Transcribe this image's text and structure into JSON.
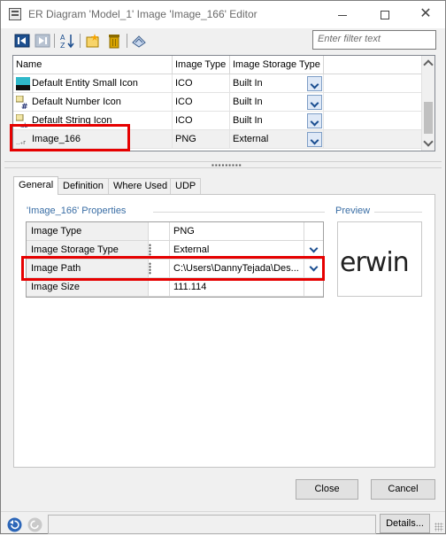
{
  "window": {
    "title": "ER Diagram 'Model_1' Image 'Image_166' Editor"
  },
  "toolbar": {
    "filter_placeholder": "Enter filter text"
  },
  "image_list": {
    "columns": [
      "Name",
      "Image Type",
      "Image Storage Type"
    ],
    "rows": [
      {
        "name": "Default Entity Small Icon",
        "type": "ICO",
        "storage": "Built In",
        "icon": "entity-icon"
      },
      {
        "name": "Default Number Icon",
        "type": "ICO",
        "storage": "Built In",
        "icon": "number-icon"
      },
      {
        "name": "Default String Icon",
        "type": "ICO",
        "storage": "Built In",
        "icon": "string-icon"
      },
      {
        "name": "Image_166",
        "type": "PNG",
        "storage": "External",
        "icon": "image-icon",
        "selected": true
      }
    ]
  },
  "tabs": [
    "General",
    "Definition",
    "Where Used",
    "UDP"
  ],
  "active_tab": "General",
  "properties": {
    "group_title": "'Image_166' Properties",
    "rows": [
      {
        "name": "Image Type",
        "value": "PNG",
        "has_dropdown": false
      },
      {
        "name": "Image Storage Type",
        "value": "External",
        "has_dropdown": true
      },
      {
        "name": "Image Path",
        "value": "C:\\Users\\DannyTejada\\Des...",
        "has_dropdown": true
      },
      {
        "name": "Image Size",
        "value": "111.114",
        "has_dropdown": false
      }
    ]
  },
  "preview": {
    "title": "Preview",
    "logo_text": "erwin"
  },
  "buttons": {
    "close": "Close",
    "cancel": "Cancel",
    "details": "Details..."
  },
  "highlight_color": "#e60000"
}
